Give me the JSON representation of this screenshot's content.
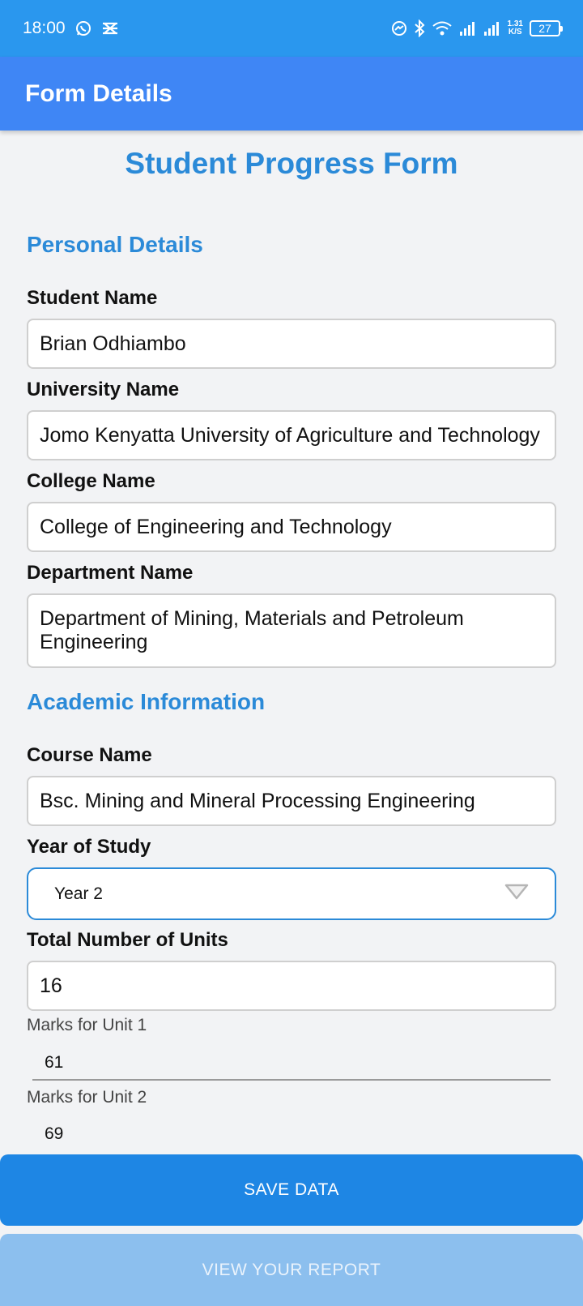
{
  "status_bar": {
    "time": "18:00",
    "net_speed_value": "1.31",
    "net_speed_unit": "K/S",
    "battery": "27",
    "icons": [
      "whatsapp-icon",
      "app-notification-icon",
      "messenger-icon",
      "bluetooth-icon",
      "wifi-icon",
      "signal-icon",
      "signal-icon-2",
      "battery-icon"
    ]
  },
  "app_bar": {
    "title": "Form Details"
  },
  "form": {
    "title": "Student Progress Form",
    "personal_section": "Personal Details",
    "student_name_label": "Student Name",
    "student_name_value": "Brian Odhiambo",
    "university_label": "University Name",
    "university_value": "Jomo Kenyatta University of Agriculture and Technology",
    "college_label": "College Name",
    "college_value": "College of Engineering and Technology",
    "department_label": "Department Name",
    "department_value": "Department of Mining, Materials and Petroleum Engineering",
    "academic_section": "Academic Information",
    "course_label": "Course Name",
    "course_value": "Bsc. Mining and Mineral Processing Engineering",
    "year_label": "Year of Study",
    "year_value": "Year 2",
    "units_label": "Total Number of Units",
    "units_value": "16",
    "unit1_label": "Marks for Unit 1",
    "unit1_value": "61",
    "unit2_label": "Marks for Unit 2",
    "unit2_value": "69"
  },
  "buttons": {
    "save": "SAVE DATA",
    "report": "VIEW YOUR REPORT"
  },
  "colors": {
    "status_bar": "#2a97ee",
    "app_bar": "#3f86f5",
    "accent": "#2b8ad8",
    "save_button": "#1e86e4",
    "report_button": "#8cbfee"
  }
}
